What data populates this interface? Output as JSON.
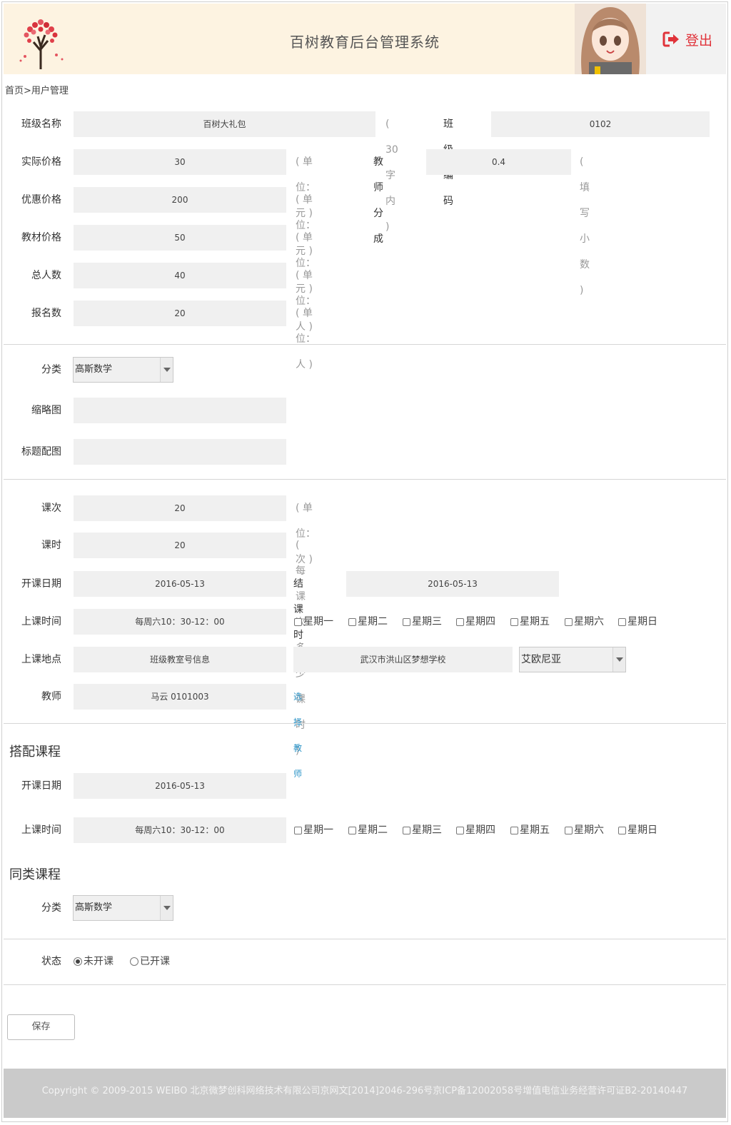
{
  "header": {
    "title": "百树教育后台管理系统",
    "logout_label": "登出",
    "logo_icon": "tree-logo-icon",
    "avatar_icon": "anime-girl-avatar"
  },
  "breadcrumb": "首页>用户管理",
  "basic": {
    "class_name_label": "班级名称",
    "class_name_value": "百树大礼包",
    "class_name_hint": "( 30字内 )",
    "class_code_label": "班级编码",
    "class_code_value": "0102",
    "actual_price_label": "实际价格",
    "actual_price_value": "30",
    "actual_price_hint": "( 单位：元 )",
    "teacher_share_label": "教师分成",
    "teacher_share_value": "0.4",
    "teacher_share_hint": "( 填写小数 )",
    "discount_price_label": "优惠价格",
    "discount_price_value": "200",
    "discount_price_hint": "( 单位：元 )",
    "material_price_label": "教材价格",
    "material_price_value": "50",
    "material_price_hint": "( 单位：元 )",
    "total_people_label": "总人数",
    "total_people_value": "40",
    "total_people_hint": "( 单位：人 )",
    "enrolled_label": "报名数",
    "enrolled_value": "20",
    "enrolled_hint": "( 单位：人 )"
  },
  "media": {
    "category_label": "分类",
    "category_value": "高斯数学",
    "thumbnail_label": "缩略图",
    "title_image_label": "标题配图"
  },
  "schedule": {
    "lessons_label": "课次",
    "lessons_value": "20",
    "lessons_hint": "( 单位：次 )",
    "hours_label": "课时",
    "hours_value": "20",
    "hours_hint": "( 每课次多少课时 )",
    "start_date_label": "开课日期",
    "start_date_value": "2016-05-13",
    "end_date_label": "结课时间",
    "end_date_value": "2016-05-13",
    "class_time_label": "上课时间",
    "class_time_value": "每周六10：30-12：00",
    "weekdays": [
      "星期一",
      "星期二",
      "星期三",
      "星期四",
      "星期五",
      "星期六",
      "星期日"
    ],
    "location_label": "上课地点",
    "location_room": "班级教室号信息",
    "location_address": "武汉市洪山区梦想学校",
    "location_select": "艾欧尼亚",
    "teacher_label": "教师",
    "teacher_value": "马云  0101003",
    "choose_teacher": "选择教师"
  },
  "combo": {
    "section_title": "搭配课程",
    "start_date_label": "开课日期",
    "start_date_value": "2016-05-13",
    "class_time_label": "上课时间",
    "class_time_value": "每周六10：30-12：00"
  },
  "similar": {
    "section_title": "同类课程",
    "category_label": "分类",
    "category_value": "高斯数学"
  },
  "status": {
    "label": "状态",
    "options": [
      "未开课",
      "已开课"
    ],
    "selected": "未开课"
  },
  "save_label": "保存",
  "footer": "Copyright © 2009-2015 WEIBO 北京微梦创科网络技术有限公司京网文[2014]2046-296号京ICP备12002058号增值电信业务经营许可证B2-20140447"
}
